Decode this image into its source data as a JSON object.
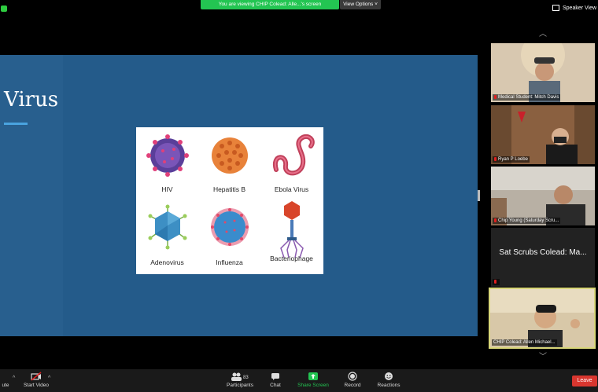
{
  "banner": {
    "text": "You are viewing CHIP Colead: Alle...'s screen",
    "view_options": "View Options"
  },
  "speaker_view": "Speaker View",
  "slide": {
    "title": "Virus",
    "viruses": [
      {
        "label": "HIV"
      },
      {
        "label": "Hepatitis B"
      },
      {
        "label": "Ebola  Virus"
      },
      {
        "label": "Adenovirus"
      },
      {
        "label": "Influenza"
      },
      {
        "label": "Bacteriophage"
      }
    ]
  },
  "participants": [
    {
      "name": "Medical Student: Mitch Davis",
      "muted": true
    },
    {
      "name": "Ryan P Loebe",
      "muted": true
    },
    {
      "name": "Chip Young (Saturday Scru...",
      "muted": true
    },
    {
      "big_name": "Sat Scrubs Colead: Ma...",
      "muted": true
    },
    {
      "name": "CHIP Colead: Allen Michael...",
      "muted": false,
      "active": true
    }
  ],
  "toolbar": {
    "unmute": "ute",
    "start_video": "Start Video",
    "participants": "Participants",
    "participants_count": "83",
    "chat": "Chat",
    "share_screen": "Share Screen",
    "record": "Record",
    "reactions": "Reactions",
    "leave": "Leave"
  },
  "colors": {
    "stage_bg": "#245b8a",
    "share_green": "#23c552",
    "leave_red": "#d8362f",
    "active_border": "#d9d77a"
  }
}
